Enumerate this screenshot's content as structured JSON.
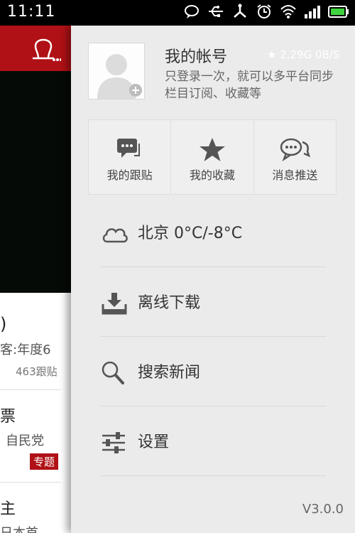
{
  "status_bar": {
    "time": "11:11",
    "icons": [
      "chat-bubble-icon",
      "usb-icon",
      "connection-icon",
      "alarm-icon",
      "wifi-icon",
      "signal-icon",
      "battery-icon"
    ]
  },
  "left_pane": {
    "items": [
      {
        "title": ")",
        "subtitle": "客:年度6",
        "meta": "463跟贴"
      },
      {
        "title": "票",
        "subtitle": "自民党",
        "badge": "专题"
      },
      {
        "title": "主",
        "subtitle": "日本首"
      }
    ]
  },
  "drawer": {
    "account": {
      "title": "我的帐号",
      "description": "只登录一次，就可以多平台同步栏目订阅、收藏等",
      "netspeed": "★ 2.29G  0B/S"
    },
    "quick_actions": [
      {
        "label": "我的跟贴",
        "icon": "comment-icon"
      },
      {
        "label": "我的收藏",
        "icon": "star-icon"
      },
      {
        "label": "消息推送",
        "icon": "message-icon"
      }
    ],
    "menu": [
      {
        "label": "北京 0°C/-8°C",
        "icon": "cloud-icon"
      },
      {
        "label": "离线下载",
        "icon": "download-icon"
      },
      {
        "label": "搜索新闻",
        "icon": "search-icon"
      },
      {
        "label": "设置",
        "icon": "settings-icon"
      }
    ],
    "version": "V3.0.0"
  },
  "colors": {
    "brand_red": "#b01116",
    "drawer_bg": "#ebebeb"
  }
}
